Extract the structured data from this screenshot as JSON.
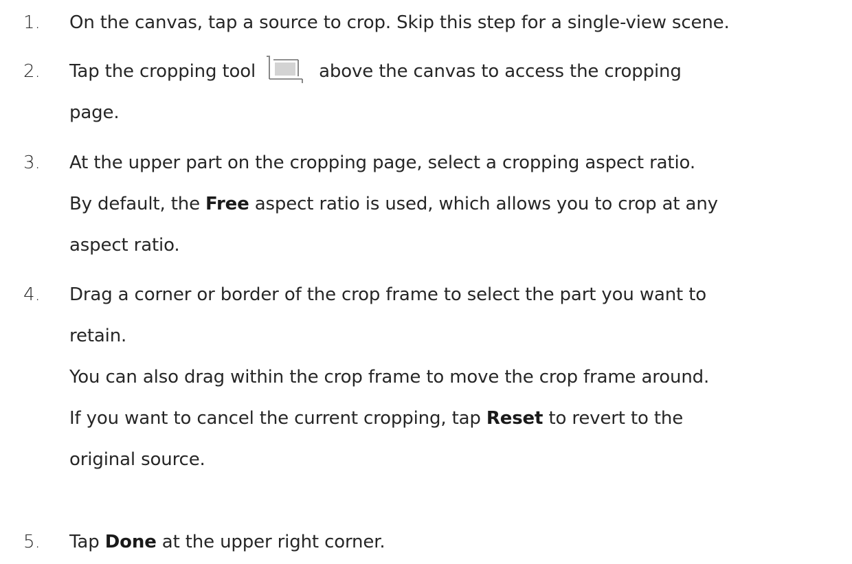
{
  "steps": [
    {
      "number": "1.",
      "lines": [
        "On the canvas, tap a source to crop. Skip this step for a single-view scene."
      ]
    },
    {
      "number": "2.",
      "line1_before": "Tap the cropping tool",
      "icon": "crop-tool-icon",
      "line1_after": "above the canvas to access the cropping",
      "line2": "page."
    },
    {
      "number": "3.",
      "line1": "At the upper part on the cropping page, select a cropping aspect ratio.",
      "line2_before": "By default, the ",
      "line2_bold": "Free",
      "line2_after": " aspect ratio is used, which allows you to crop at any",
      "line3": "aspect ratio."
    },
    {
      "number": "4.",
      "line1": "Drag a corner or border of the crop frame to select the part you want to",
      "line2": "retain.",
      "line3": "You can also drag within the crop frame to move the crop frame around.",
      "line4_before": "If you want to cancel the current cropping, tap ",
      "line4_bold": "Reset",
      "line4_after": " to revert to the",
      "line5": "original source."
    },
    {
      "number": "5.",
      "line1_before": "Tap ",
      "line1_bold": "Done",
      "line1_after": " at the upper right corner."
    }
  ]
}
